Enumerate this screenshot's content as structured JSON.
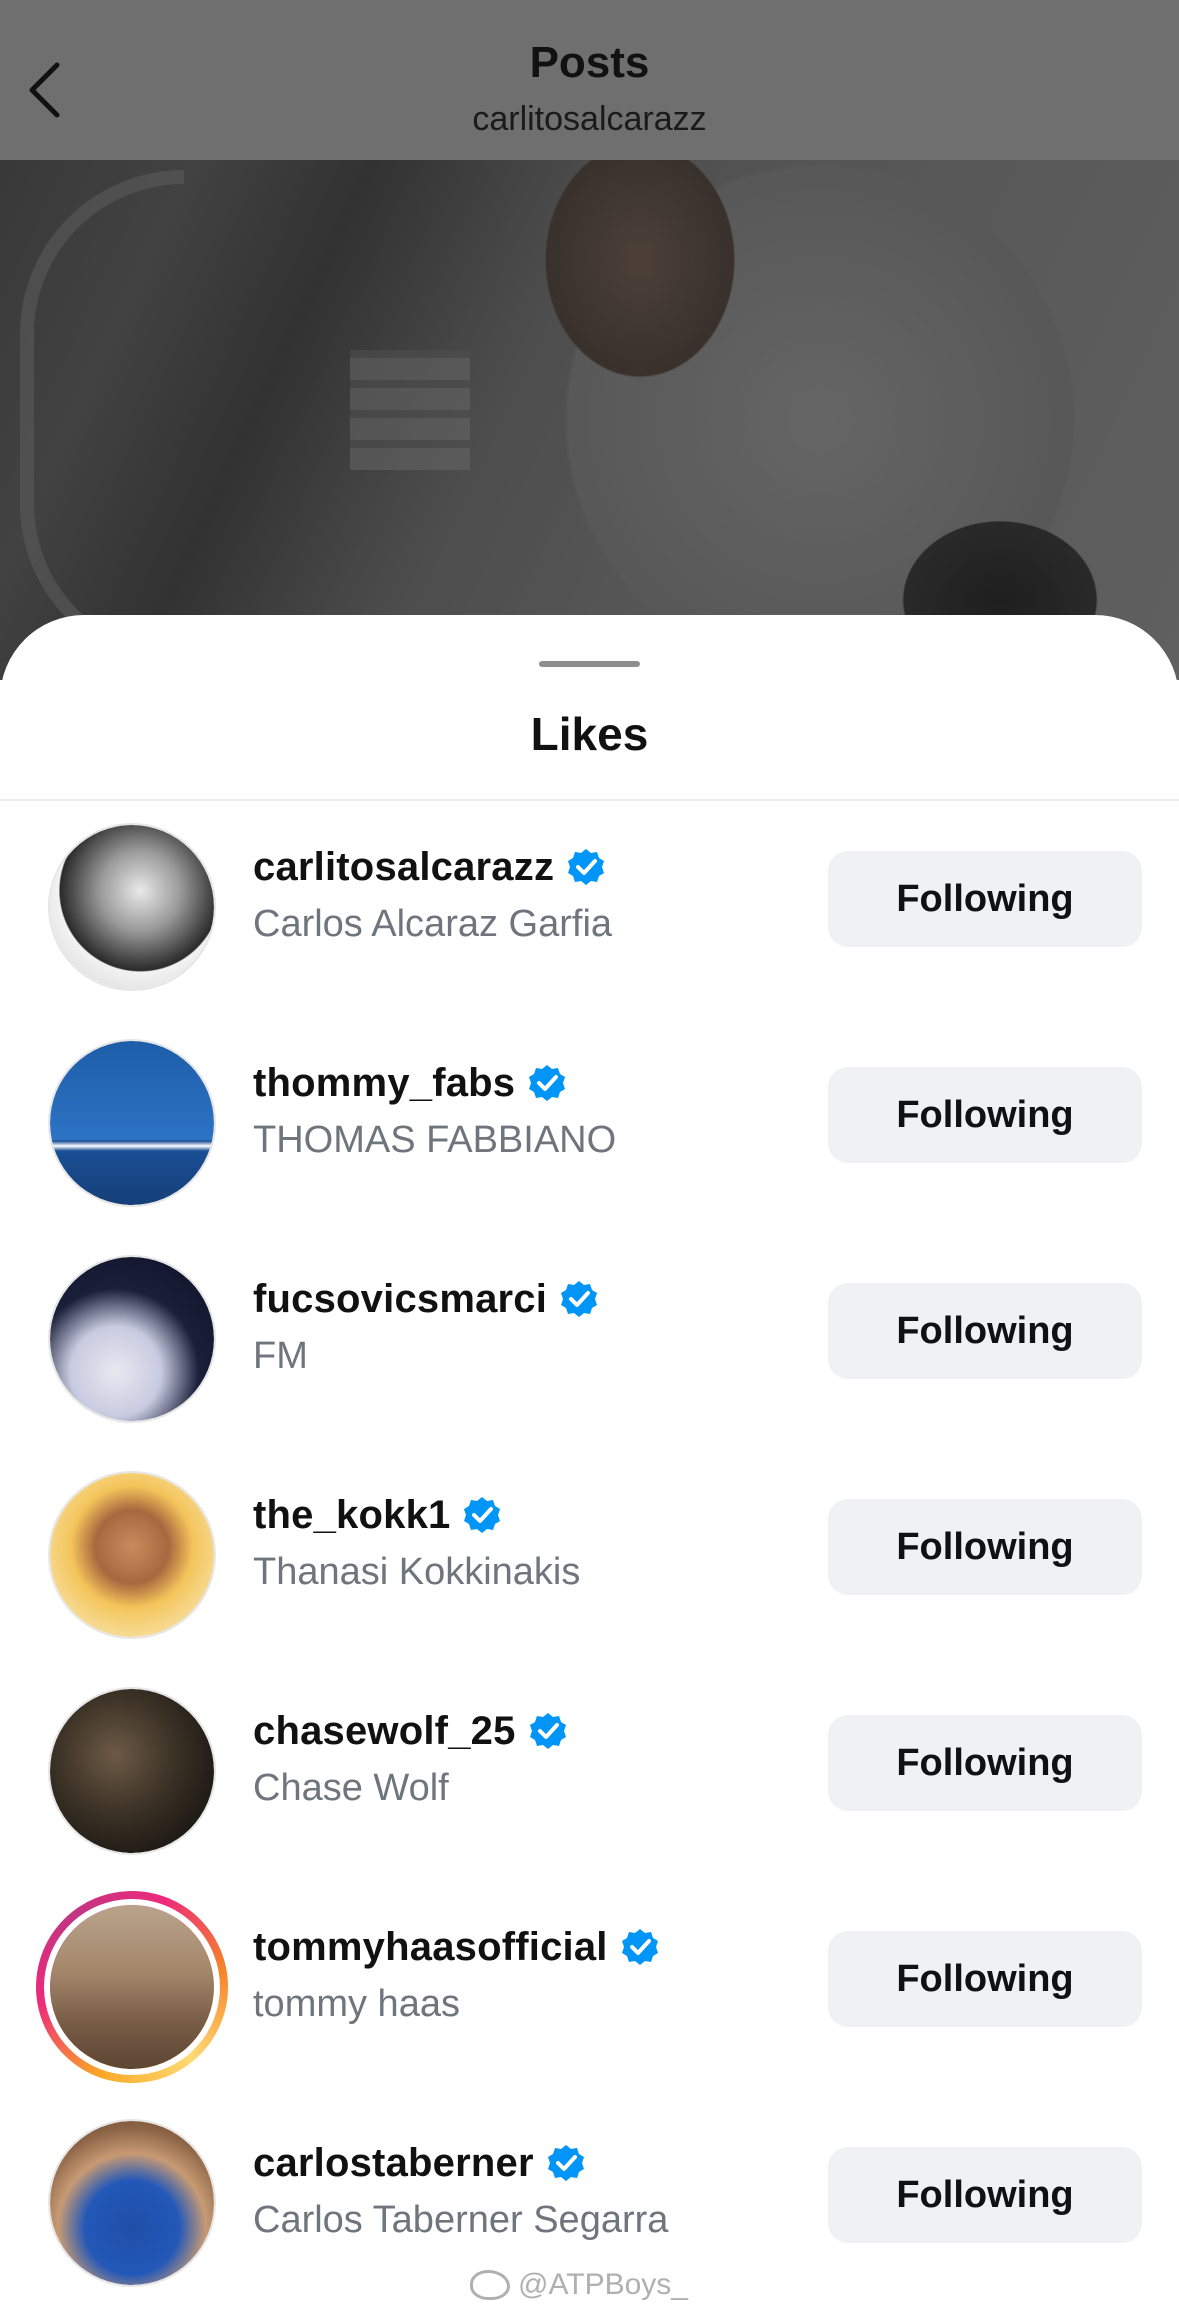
{
  "header": {
    "title": "Posts",
    "subtitle": "carlitosalcarazz"
  },
  "sheet": {
    "title": "Likes"
  },
  "icons": {
    "back": "chevron-left-icon",
    "verified": "verified-badge-icon"
  },
  "colors": {
    "verified_blue": "#0095f6",
    "button_bg": "#eff1f3",
    "secondary_text": "#6f757c"
  },
  "likes": [
    {
      "username": "carlitosalcarazz",
      "full_name": "Carlos Alcaraz Garfia",
      "verified": true,
      "button": "Following",
      "story_ring": false
    },
    {
      "username": "thommy_fabs",
      "full_name": "THOMAS FABBIANO",
      "verified": true,
      "button": "Following",
      "story_ring": false
    },
    {
      "username": "fucsovicsmarci",
      "full_name": "FM",
      "verified": true,
      "button": "Following",
      "story_ring": false
    },
    {
      "username": "the_kokk1",
      "full_name": "Thanasi Kokkinakis",
      "verified": true,
      "button": "Following",
      "story_ring": false
    },
    {
      "username": "chasewolf_25",
      "full_name": "Chase Wolf",
      "verified": true,
      "button": "Following",
      "story_ring": false
    },
    {
      "username": "tommyhaasofficial",
      "full_name": "tommy haas",
      "verified": true,
      "button": "Following",
      "story_ring": true
    },
    {
      "username": "carlostaberner",
      "full_name": "Carlos Taberner Segarra",
      "verified": true,
      "button": "Following",
      "story_ring": false
    }
  ],
  "watermark": "@ATPBoys_"
}
